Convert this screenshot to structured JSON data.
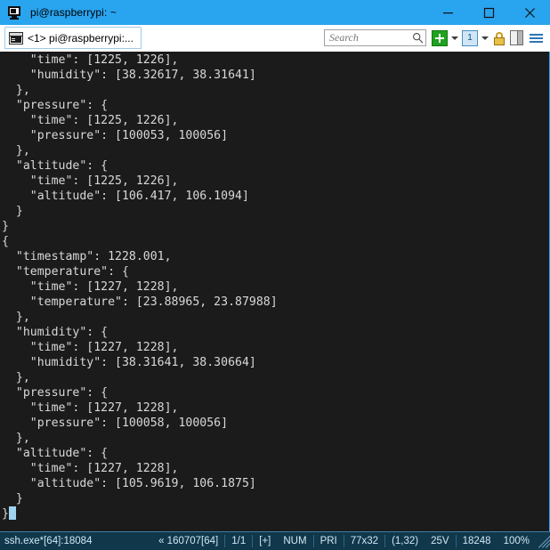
{
  "window": {
    "title": "pi@raspberrypi: ~",
    "icon": "terminal-monitor-icon",
    "minimize_label": "–",
    "maximize_label": "□",
    "close_label": "✕"
  },
  "tabbar": {
    "tabs": [
      {
        "label": "<1> pi@raspberrypi:...",
        "icon": "console-icon",
        "active": true
      }
    ],
    "search": {
      "placeholder": "Search",
      "value": "",
      "icon": "magnifier-icon"
    },
    "buttons": [
      {
        "name": "new-session-button",
        "icon": "green-plus-icon",
        "label": ""
      },
      {
        "name": "new-session-dropdown",
        "icon": "chevron-down-icon",
        "label": ""
      },
      {
        "name": "tab-switch-button",
        "icon": "tab-number-icon",
        "label": "1"
      },
      {
        "name": "tab-switch-dropdown",
        "icon": "chevron-down-icon",
        "label": ""
      },
      {
        "name": "lock-button",
        "icon": "lock-icon",
        "label": ""
      },
      {
        "name": "toggle-panel-button",
        "icon": "side-panel-icon",
        "label": ""
      },
      {
        "name": "menu-button",
        "icon": "hamburger-menu-icon",
        "label": ""
      }
    ]
  },
  "terminal": {
    "lines": [
      "    \"time\": [1225, 1226],",
      "    \"humidity\": [38.32617, 38.31641]",
      "  },",
      "  \"pressure\": {",
      "    \"time\": [1225, 1226],",
      "    \"pressure\": [100053, 100056]",
      "  },",
      "  \"altitude\": {",
      "    \"time\": [1225, 1226],",
      "    \"altitude\": [106.417, 106.1094]",
      "  }",
      "}",
      "{",
      "  \"timestamp\": 1228.001,",
      "  \"temperature\": {",
      "    \"time\": [1227, 1228],",
      "    \"temperature\": [23.88965, 23.87988]",
      "  },",
      "  \"humidity\": {",
      "    \"time\": [1227, 1228],",
      "    \"humidity\": [38.31641, 38.30664]",
      "  },",
      "  \"pressure\": {",
      "    \"time\": [1227, 1228],",
      "    \"pressure\": [100058, 100056]",
      "  },",
      "  \"altitude\": {",
      "    \"time\": [1227, 1228],",
      "    \"altitude\": [105.9619, 106.1875]",
      "  }",
      "}",
      ""
    ],
    "cursor_line_index": 30,
    "background": "#1b1b1b",
    "foreground": "#d8d8d8",
    "cursor_color": "#9fd4f2"
  },
  "statusbar": {
    "process": "ssh.exe*[64]:18084",
    "session": "« 160707[64]",
    "pages": "1/1",
    "expanded": "[+]",
    "numlock": "NUM",
    "priority": "PRI",
    "size": "77x32",
    "position": "(1,32)",
    "voltage": "25V",
    "bytes": "18248",
    "zoom": "100%",
    "background": "#11374b",
    "foreground": "#cfe8f3"
  },
  "colors": {
    "titlebar": "#29a4ef",
    "accent": "#29a4ef",
    "tabstrip": "#ffffff"
  }
}
